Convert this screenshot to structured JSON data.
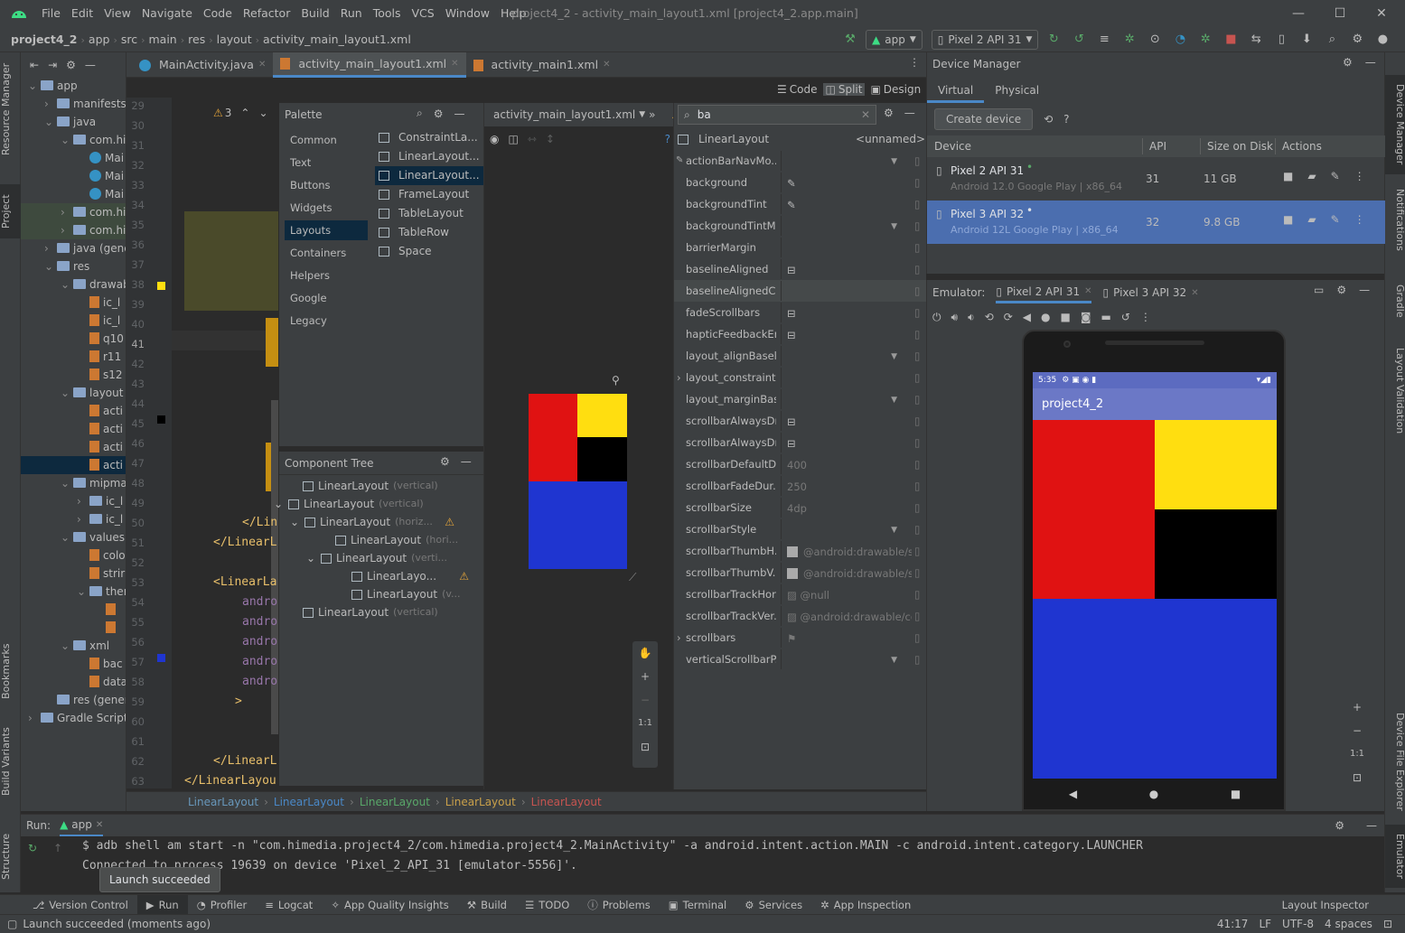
{
  "title_bar": {
    "menu": [
      "File",
      "Edit",
      "View",
      "Navigate",
      "Code",
      "Refactor",
      "Build",
      "Run",
      "Tools",
      "VCS",
      "Window",
      "Help"
    ],
    "window_title": "project4_2 - activity_main_layout1.xml [project4_2.app.main]",
    "minimize": "—",
    "maximize": "☐",
    "close": "✕"
  },
  "nav_bar": {
    "breadcrumbs": [
      "project4_2",
      "app",
      "src",
      "main",
      "res",
      "layout",
      "activity_main_layout1.xml"
    ],
    "run_config": "app",
    "device": "Pixel 2 API 31"
  },
  "left_strip": {
    "tabs": [
      "Resource Manager",
      "Project",
      "Bookmarks",
      "Build Variants",
      "Structure"
    ]
  },
  "right_strip": {
    "tabs": [
      "Device Manager",
      "Notifications",
      "Gradle",
      "Layout Validation",
      "Device File Explorer",
      "Emulator"
    ]
  },
  "project_tree": {
    "items": [
      {
        "label": "app",
        "type": "folder"
      },
      {
        "label": "manifests",
        "type": "folder"
      },
      {
        "label": "java",
        "type": "folder"
      },
      {
        "label": "com.hi",
        "type": "folder"
      },
      {
        "label": "Mai",
        "type": "class"
      },
      {
        "label": "Mai",
        "type": "class"
      },
      {
        "label": "Mai",
        "type": "class"
      },
      {
        "label": "com.hi",
        "type": "folder"
      },
      {
        "label": "com.hi",
        "type": "folder"
      },
      {
        "label": "java (gene",
        "type": "folder"
      },
      {
        "label": "res",
        "type": "folder"
      },
      {
        "label": "drawab",
        "type": "folder"
      },
      {
        "label": "ic_l",
        "type": "xml"
      },
      {
        "label": "ic_l",
        "type": "xml"
      },
      {
        "label": "q10",
        "type": "xml"
      },
      {
        "label": "r11",
        "type": "xml"
      },
      {
        "label": "s12",
        "type": "xml"
      },
      {
        "label": "layout",
        "type": "folder"
      },
      {
        "label": "acti",
        "type": "xml"
      },
      {
        "label": "acti",
        "type": "xml"
      },
      {
        "label": "acti",
        "type": "xml"
      },
      {
        "label": "acti",
        "type": "xml"
      },
      {
        "label": "mipma",
        "type": "folder"
      },
      {
        "label": "ic_l",
        "type": "folder"
      },
      {
        "label": "ic_l",
        "type": "folder"
      },
      {
        "label": "values",
        "type": "folder"
      },
      {
        "label": "colo",
        "type": "xml"
      },
      {
        "label": "strir",
        "type": "xml"
      },
      {
        "label": "ther",
        "type": "folder"
      },
      {
        "label": "",
        "type": "xml"
      },
      {
        "label": "",
        "type": "xml"
      },
      {
        "label": "xml",
        "type": "folder"
      },
      {
        "label": "bac",
        "type": "xml"
      },
      {
        "label": "data",
        "type": "xml"
      },
      {
        "label": "res (genera",
        "type": "folder"
      },
      {
        "label": "Gradle Scripts",
        "type": "folder"
      }
    ]
  },
  "editor_tabs": [
    {
      "label": "MainActivity.java"
    },
    {
      "label": "activity_main_layout1.xml"
    },
    {
      "label": "activity_main1.xml"
    }
  ],
  "view_modes": {
    "code": "Code",
    "split": "Split",
    "design": "Design"
  },
  "editor": {
    "warnings": "3",
    "line_numbers": [
      "29",
      "30",
      "31",
      "32",
      "33",
      "34",
      "35",
      "36",
      "37",
      "38",
      "39",
      "40",
      "41",
      "42",
      "43",
      "44",
      "45",
      "46",
      "47",
      "48",
      "49",
      "50",
      "51",
      "52",
      "53",
      "54",
      "55",
      "56",
      "57",
      "58",
      "59",
      "60",
      "61",
      "62",
      "63"
    ],
    "code_lines": [
      {
        "line": "50",
        "text": "</Lin"
      },
      {
        "line": "51",
        "text": "</LinearL"
      },
      {
        "line": "53",
        "text": "<LinearLa"
      },
      {
        "line": "54",
        "text": "andro"
      },
      {
        "line": "55",
        "text": "andro"
      },
      {
        "line": "56",
        "text": "andro"
      },
      {
        "line": "57",
        "text": "andro"
      },
      {
        "line": "58",
        "text": "andro"
      },
      {
        "line": "59",
        "text": ">"
      },
      {
        "line": "62",
        "text": "</LinearL"
      },
      {
        "line": "63",
        "text": "</LinearLayou"
      }
    ]
  },
  "palette": {
    "title": "Palette",
    "categories": [
      "Common",
      "Text",
      "Buttons",
      "Widgets",
      "Layouts",
      "Containers",
      "Helpers",
      "Google",
      "Legacy"
    ],
    "items": [
      "ConstraintLa...",
      "LinearLayout...",
      "LinearLayout...",
      "FrameLayout",
      "TableLayout",
      "TableRow",
      "Space"
    ]
  },
  "component_tree": {
    "title": "Component Tree",
    "rows": [
      {
        "label": "LinearLayout",
        "attr": "(vertical)"
      },
      {
        "label": "LinearLayout",
        "attr": "(vertical)"
      },
      {
        "label": "LinearLayout",
        "attr": "(horiz..."
      },
      {
        "label": "LinearLayout",
        "attr": "(hori..."
      },
      {
        "label": "LinearLayout",
        "attr": "(verti..."
      },
      {
        "label": "LinearLayo...",
        "attr": ""
      },
      {
        "label": "LinearLayout",
        "attr": "(v..."
      },
      {
        "label": "LinearLayout",
        "attr": "(vertical)"
      }
    ]
  },
  "design_header": {
    "file": "activity_main_layout1.xml",
    "more": "»",
    "zoom_fit": "1:1"
  },
  "attributes": {
    "search_value": "ba",
    "component": "LinearLayout",
    "component_id": "<unnamed>",
    "rows": [
      {
        "name": "actionBarNavMo...",
        "value": ""
      },
      {
        "name": "background",
        "value": ""
      },
      {
        "name": "backgroundTint",
        "value": ""
      },
      {
        "name": "backgroundTintM...",
        "value": ""
      },
      {
        "name": "barrierMargin",
        "value": ""
      },
      {
        "name": "baselineAligned",
        "value": ""
      },
      {
        "name": "baselineAlignedC...",
        "value": ""
      },
      {
        "name": "fadeScrollbars",
        "value": ""
      },
      {
        "name": "hapticFeedbackEn...",
        "value": ""
      },
      {
        "name": "layout_alignBaseli...",
        "value": ""
      },
      {
        "name": "layout_constraints",
        "value": ""
      },
      {
        "name": "layout_marginBas...",
        "value": ""
      },
      {
        "name": "scrollbarAlwaysDr...",
        "value": ""
      },
      {
        "name": "scrollbarAlwaysDr...",
        "value": ""
      },
      {
        "name": "scrollbarDefaultD...",
        "value": "400"
      },
      {
        "name": "scrollbarFadeDur...",
        "value": "250"
      },
      {
        "name": "scrollbarSize",
        "value": "4dp"
      },
      {
        "name": "scrollbarStyle",
        "value": ""
      },
      {
        "name": "scrollbarThumbH...",
        "value": "@android:drawable/scr"
      },
      {
        "name": "scrollbarThumbV...",
        "value": "@android:drawable/scr"
      },
      {
        "name": "scrollbarTrackHor...",
        "value": "@null"
      },
      {
        "name": "scrollbarTrackVer...",
        "value": "@android:drawable/coi"
      },
      {
        "name": "scrollbars",
        "value": ""
      },
      {
        "name": "verticalScrollbarP...",
        "value": ""
      }
    ]
  },
  "device_manager": {
    "title": "Device Manager",
    "tabs": [
      "Virtual",
      "Physical"
    ],
    "create_button": "Create device",
    "columns": [
      "Device",
      "API",
      "Size on Disk",
      "Actions"
    ],
    "devices": [
      {
        "name": "Pixel 2 API 31",
        "desc": "Android 12.0 Google Play | x86_64",
        "api": "31",
        "size": "11 GB"
      },
      {
        "name": "Pixel 3 API 32",
        "desc": "Android 12L Google Play | x86_64",
        "api": "32",
        "size": "9.8 GB"
      }
    ]
  },
  "emulator": {
    "label": "Emulator:",
    "tabs": [
      "Pixel 2 API 31",
      "Pixel 3 API 32"
    ],
    "phone_time": "5:35",
    "app_title": "project4_2",
    "zoom_1to1": "1:1"
  },
  "design_breadcrumbs": [
    "LinearLayout",
    "LinearLayout",
    "LinearLayout",
    "LinearLayout",
    "LinearLayout"
  ],
  "run_panel": {
    "label": "Run:",
    "config": "app",
    "console": [
      "$ adb shell am start -n \"com.himedia.project4_2/com.himedia.project4_2.MainActivity\" -a android.intent.action.MAIN -c android.intent.category.LAUNCHER",
      "Connected to process 19639 on device 'Pixel_2_API_31 [emulator-5556]'."
    ],
    "tooltip": "Launch succeeded"
  },
  "tool_windows": [
    "Version Control",
    "Run",
    "Profiler",
    "Logcat",
    "App Quality Insights",
    "Build",
    "TODO",
    "Problems",
    "Terminal",
    "Services",
    "App Inspection"
  ],
  "layout_inspector": "Layout Inspector",
  "status_bar": {
    "message": "Launch succeeded (moments ago)",
    "position": "41:17",
    "line_sep": "LF",
    "encoding": "UTF-8",
    "indent": "4 spaces"
  },
  "colors": {
    "red": "#e01212",
    "yellow": "#ffde10",
    "black": "#000000",
    "blue": "#1f35d0",
    "accent": "#4a88c7",
    "selection": "#4b6eaf",
    "toolbar_purple": "#6b78c6"
  }
}
